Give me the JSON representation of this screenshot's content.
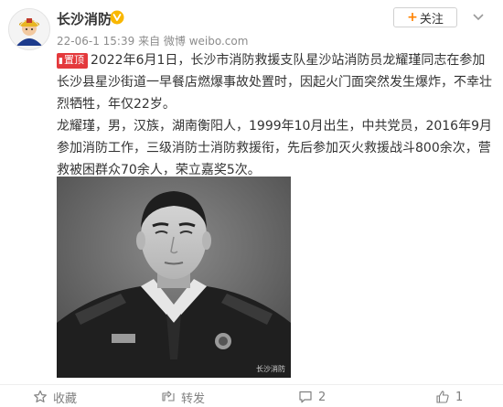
{
  "account": {
    "name": "长沙消防",
    "follow_label": "关注"
  },
  "meta": {
    "time": "22-06-1 15:39",
    "source": "来自 微博 weibo.com"
  },
  "post": {
    "tag_label": "置顶",
    "paragraph1": "2022年6月1日，长沙市消防救援支队星沙站消防员龙耀瑾同志在参加长沙县星沙街道一早餐店燃爆事故处置时，因起火门面突然发生爆炸，不幸壮烈牺牲，年仅22岁。",
    "paragraph2": "龙耀瑾，男，汉族，湖南衡阳人，1999年10月出生，中共党员，2016年9月参加消防工作，三级消防士消防救援衔，先后参加灭火救援战斗800余次，营救被困群众70余人，荣立嘉奖5次。"
  },
  "photo": {
    "watermark": "长沙消防"
  },
  "actions": {
    "favorite_label": "收藏",
    "repost_label": "转发",
    "comment_count": "2",
    "like_count": "1"
  },
  "colors": {
    "brand_orange": "#ff8200",
    "tag_red": "#e4393c",
    "verified_yellow": "#f9b700",
    "muted_text": "#808080"
  }
}
